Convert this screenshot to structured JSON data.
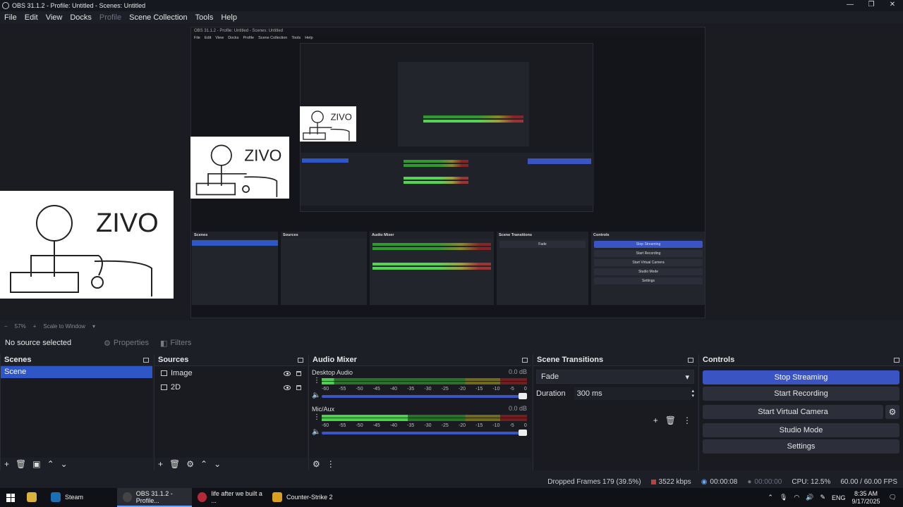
{
  "window": {
    "title": "OBS 31.1.2 - Profile: Untitled - Scenes: Untitled",
    "controls": [
      "—",
      "❐",
      "✕"
    ]
  },
  "menu": [
    {
      "label": "File",
      "enabled": true
    },
    {
      "label": "Edit",
      "enabled": true
    },
    {
      "label": "View",
      "enabled": true
    },
    {
      "label": "Docks",
      "enabled": true
    },
    {
      "label": "Profile",
      "enabled": false
    },
    {
      "label": "Scene Collection",
      "enabled": true
    },
    {
      "label": "Tools",
      "enabled": true
    },
    {
      "label": "Help",
      "enabled": true
    }
  ],
  "preview": {
    "sketch_text": "ZIVO",
    "nested_title": "OBS 31.1.2 - Profile: Untitled - Scenes: Untitled",
    "nested_menu": [
      "File",
      "Edit",
      "View",
      "Docks",
      "Profile",
      "Scene Collection",
      "Tools",
      "Help"
    ]
  },
  "zoombar": {
    "minus": "−",
    "zoom": "57%",
    "plus": "+",
    "mode": "Scale to Window"
  },
  "propbar": {
    "no_source": "No source selected",
    "properties": "Properties",
    "filters": "Filters"
  },
  "scenes": {
    "title": "Scenes",
    "items": [
      "Scene"
    ],
    "toolbar": [
      "+",
      "🗑",
      "▣",
      "⌃",
      "⌄"
    ]
  },
  "sources": {
    "title": "Sources",
    "items": [
      {
        "name": "Image",
        "icon": "image-icon"
      },
      {
        "name": "2D",
        "icon": "display-icon"
      }
    ],
    "toolbar": [
      "+",
      "🗑",
      "⚙",
      "⌃",
      "⌄"
    ]
  },
  "mixer": {
    "title": "Audio Mixer",
    "scale": [
      "-60",
      "-55",
      "-50",
      "-45",
      "-40",
      "-35",
      "-30",
      "-25",
      "-20",
      "-15",
      "-10",
      "-5",
      "0"
    ],
    "channels": [
      {
        "name": "Desktop Audio",
        "db": "0.0 dB",
        "level": 0.06
      },
      {
        "name": "Mic/Aux",
        "db": "0.0 dB",
        "level": 0.42
      }
    ]
  },
  "transitions": {
    "title": "Scene Transitions",
    "selected": "Fade",
    "duration_label": "Duration",
    "duration_value": "300 ms"
  },
  "controls": {
    "title": "Controls",
    "stop_streaming": "Stop Streaming",
    "start_recording": "Start Recording",
    "start_virtual_camera": "Start Virtual Camera",
    "studio_mode": "Studio Mode",
    "settings": "Settings"
  },
  "status": {
    "dropped": "Dropped Frames 179 (39.5%)",
    "bitrate": "3522 kbps",
    "stream_time": "00:00:08",
    "rec_time": "00:00:00",
    "cpu": "CPU: 12.5%",
    "fps": "60.00 / 60.00 FPS"
  },
  "taskbar": {
    "apps": [
      {
        "label": "Steam",
        "active": false,
        "color": "#1b6fb3"
      },
      {
        "label": "OBS 31.1.2 - Profile...",
        "active": true,
        "color": "#444"
      },
      {
        "label": "life after we built a ...",
        "active": false,
        "color": "#b32a3b"
      },
      {
        "label": "Counter-Strike 2",
        "active": false,
        "color": "#d9a021"
      }
    ],
    "lang": "ENG",
    "time": "8:35 AM",
    "date": "9/17/2025"
  },
  "colors": {
    "accent": "#3b54c4",
    "selection": "#2e56c7",
    "background": "#1d1f26"
  }
}
